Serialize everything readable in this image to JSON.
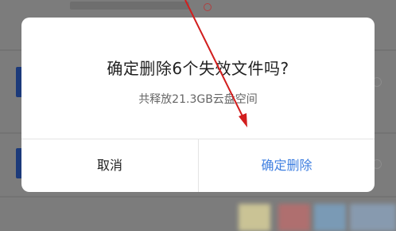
{
  "dialog": {
    "title": "确定删除6个失效文件吗?",
    "message": "共释放21.3GB云盘空间",
    "cancel_label": "取消",
    "confirm_label": "确定删除"
  },
  "colors": {
    "overlay": "#7c7c7c",
    "dialog_bg": "#ffffff",
    "confirm_text": "#3f7fe0",
    "annotation_arrow": "#d21e1e"
  },
  "icons": {
    "annotation": "red-arrow-icon"
  }
}
